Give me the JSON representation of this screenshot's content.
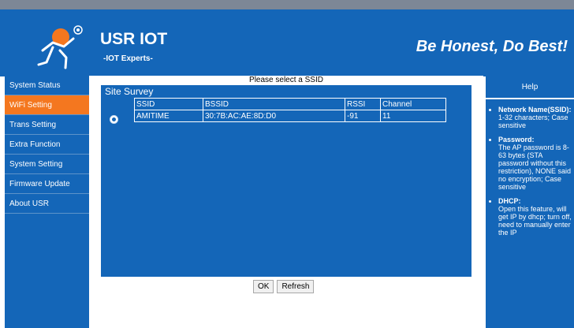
{
  "header": {
    "brand": "USR IOT",
    "subbrand": "-IOT Experts-",
    "slogan": "Be Honest, Do Best!"
  },
  "sidebar": {
    "items": [
      {
        "label": "System Status"
      },
      {
        "label": "WiFi Setting"
      },
      {
        "label": "Trans Setting"
      },
      {
        "label": "Extra Function"
      },
      {
        "label": "System Setting"
      },
      {
        "label": "Firmware Update"
      },
      {
        "label": "About USR"
      }
    ],
    "active_index": 1
  },
  "main": {
    "prompt": "Please select a SSID",
    "panel_title": "Site Survey",
    "table": {
      "headers": [
        "SSID",
        "BSSID",
        "RSSI",
        "Channel"
      ],
      "rows": [
        {
          "ssid": "AMITIME",
          "bssid": "30:7B:AC:AE:8D:D0",
          "rssi": "-91",
          "channel": "11",
          "selected": true
        }
      ]
    },
    "buttons": {
      "ok": "OK",
      "refresh": "Refresh"
    }
  },
  "help": {
    "title": "Help",
    "items": [
      {
        "term": "Network Name(SSID):",
        "desc": "1-32 characters; Case sensitive"
      },
      {
        "term": "Password:",
        "desc": "The AP password is 8-63 bytes (STA password without this restriction), NONE said no encryption; Case sensitive"
      },
      {
        "term": "DHCP:",
        "desc": "Open this feature, will get IP by dhcp; turn off, need to manually enter the IP"
      }
    ]
  },
  "colors": {
    "primary_blue": "#1466b8",
    "active_orange": "#f4771f"
  }
}
